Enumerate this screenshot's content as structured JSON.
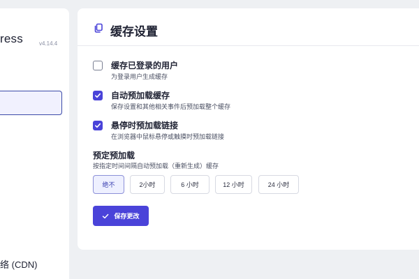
{
  "sidebar": {
    "brand": "ress",
    "version": "v4.14.4",
    "nav_cdn_label": "络 (CDN)"
  },
  "header": {
    "title": "缓存设置",
    "icon": "copy-icon"
  },
  "options": [
    {
      "title": "缓存已登录的用户",
      "description": "为登录用户生成缓存",
      "checked": false
    },
    {
      "title": "自动预加载缓存",
      "description": "保存设置和其他相关事件后预加载整个缓存",
      "checked": true
    },
    {
      "title": "悬停时预加载链接",
      "description": "在浏览器中鼠标悬停或触摸时预加载链接",
      "checked": true
    }
  ],
  "schedule": {
    "title": "预定预加载",
    "description": "按指定时间间隔自动预加载（重新生成）缓存",
    "choices": [
      "绝不",
      "2小时",
      "6 小时",
      "12 小时",
      "24 小时"
    ],
    "selected": "绝不"
  },
  "save_button": {
    "label": "保存更改",
    "icon": "check-icon"
  },
  "colors": {
    "accent": "#4a43d9",
    "page_bg": "#eef0f3",
    "card_bg": "#ffffff"
  }
}
